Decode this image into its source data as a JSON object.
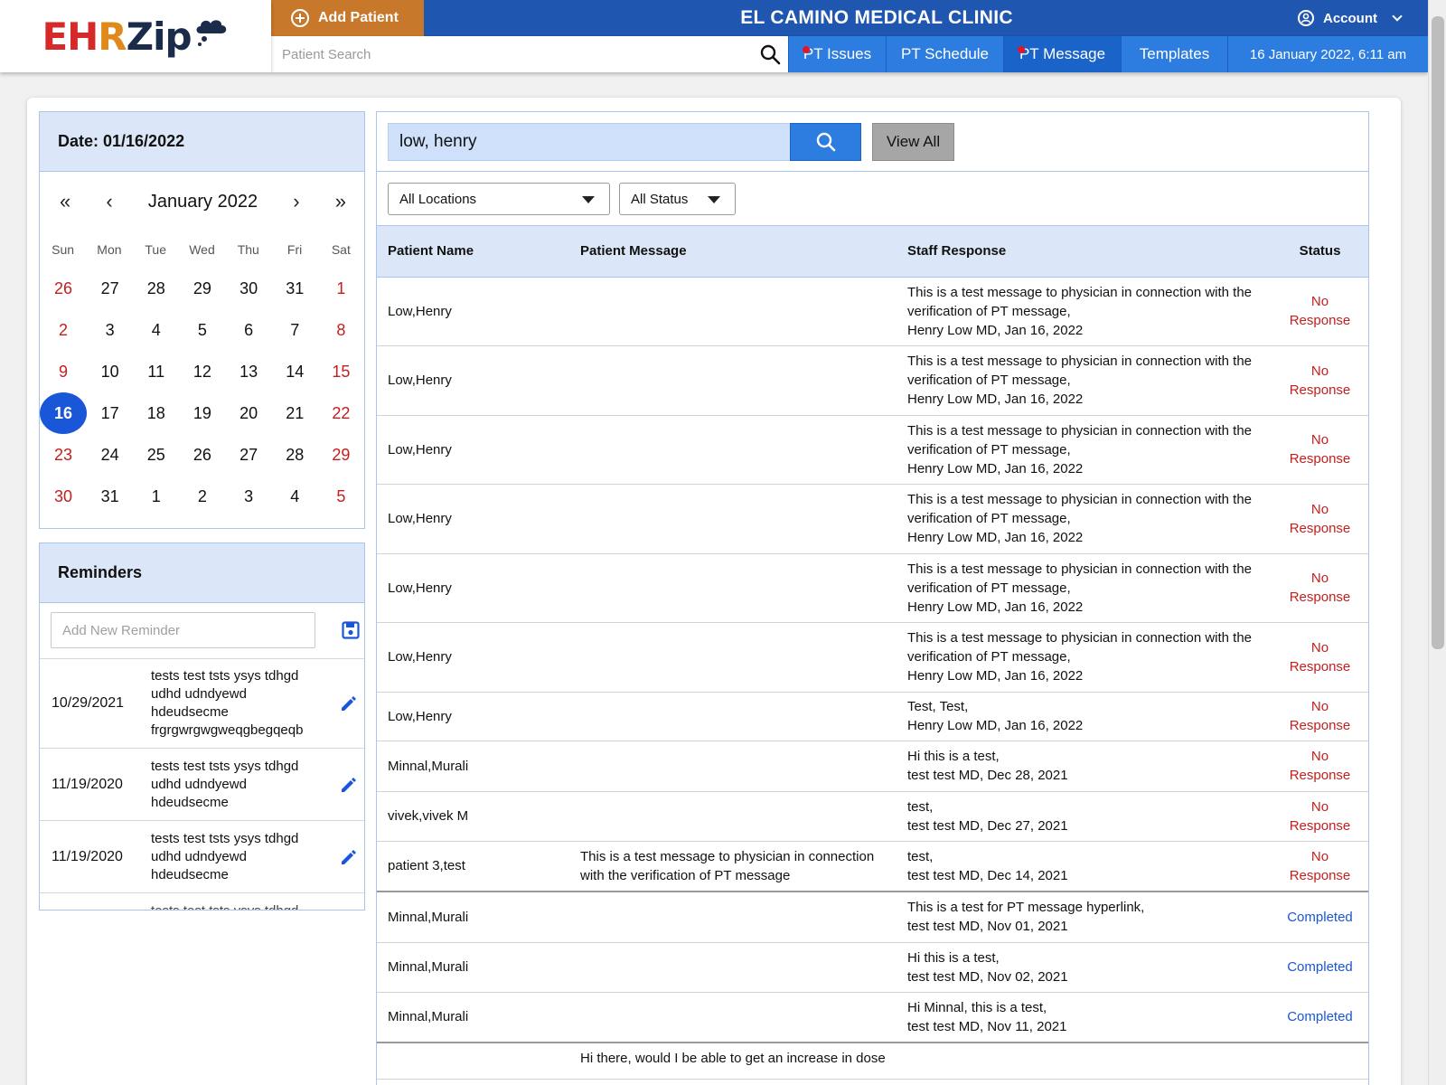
{
  "logo": {
    "part1": "EH",
    "part2": "R",
    "part3": "Zip"
  },
  "header": {
    "add_patient": "Add Patient",
    "clinic_name": "EL CAMINO MEDICAL CLINIC",
    "account": "Account"
  },
  "nav": {
    "search_placeholder": "Patient Search",
    "tabs": [
      {
        "label": "PT Issues",
        "badge": true
      },
      {
        "label": "PT Schedule",
        "badge": false
      },
      {
        "label": "PT Message",
        "badge": true,
        "active": true
      },
      {
        "label": "Templates",
        "badge": false
      }
    ],
    "datetime": "16 January 2022, 6:11 am"
  },
  "calendar": {
    "date_label": "Date: 01/16/2022",
    "nav_first": "«",
    "nav_prev": "‹",
    "nav_next": "›",
    "nav_last": "»",
    "month": "January 2022",
    "weekdays": [
      "Sun",
      "Mon",
      "Tue",
      "Wed",
      "Thu",
      "Fri",
      "Sat"
    ],
    "weeks": [
      [
        "26",
        "27",
        "28",
        "29",
        "30",
        "31",
        "1"
      ],
      [
        "2",
        "3",
        "4",
        "5",
        "6",
        "7",
        "8"
      ],
      [
        "9",
        "10",
        "11",
        "12",
        "13",
        "14",
        "15"
      ],
      [
        "16",
        "17",
        "18",
        "19",
        "20",
        "21",
        "22"
      ],
      [
        "23",
        "24",
        "25",
        "26",
        "27",
        "28",
        "29"
      ],
      [
        "30",
        "31",
        "1",
        "2",
        "3",
        "4",
        "5"
      ]
    ],
    "selected_day": "16"
  },
  "reminders": {
    "title": "Reminders",
    "placeholder": "Add New Reminder",
    "items": [
      {
        "date": "10/29/2021",
        "text": "tests test tsts ysys tdhgd udhd udndyewd hdeudsecme frgrgwrgwgweqgbegqeqb"
      },
      {
        "date": "11/19/2020",
        "text": "tests test tsts ysys tdhgd udhd udndyewd hdeudsecme"
      },
      {
        "date": "11/19/2020",
        "text": "tests test tsts ysys tdhgd udhd udndyewd hdeudsecme"
      }
    ],
    "cut_off_text": "tests test tsts ysys tdhgd"
  },
  "messages": {
    "search_value": "low, henry",
    "view_all": "View All",
    "location_filter": "All Locations",
    "status_filter": "All Status",
    "columns": [
      "Patient Name",
      "Patient Message",
      "Staff Response",
      "Status"
    ],
    "rows": [
      {
        "name": "Low,Henry",
        "message": "",
        "response": [
          "This is a test message to physician in connection with the verification of PT message,",
          "Henry Low MD, Jan 16, 2022"
        ],
        "status": "No Response"
      },
      {
        "name": "Low,Henry",
        "message": "",
        "response": [
          "This is a test message to physician in connection with the verification of PT message,",
          "Henry Low MD, Jan 16, 2022"
        ],
        "status": "No Response"
      },
      {
        "name": "Low,Henry",
        "message": "",
        "response": [
          "This is a test message to physician in connection with the verification of PT message,",
          "Henry Low MD, Jan 16, 2022"
        ],
        "status": "No Response"
      },
      {
        "name": "Low,Henry",
        "message": "",
        "response": [
          "This is a test message to physician in connection with the verification of PT message,",
          "Henry Low MD, Jan 16, 2022"
        ],
        "status": "No Response"
      },
      {
        "name": "Low,Henry",
        "message": "",
        "response": [
          "This is a test message to physician in connection with the verification of PT message,",
          "Henry Low MD, Jan 16, 2022"
        ],
        "status": "No Response"
      },
      {
        "name": "Low,Henry",
        "message": "",
        "response": [
          "This is a test message to physician in connection with the verification of PT message,",
          "Henry Low MD, Jan 16, 2022"
        ],
        "status": "No Response"
      },
      {
        "name": "Low,Henry",
        "message": "",
        "response": [
          "Test, Test,",
          "Henry Low MD, Jan 16, 2022"
        ],
        "status": "No Response"
      },
      {
        "name": "Minnal,Murali",
        "message": "",
        "response": [
          "Hi this is a test,",
          "test test MD, Dec 28, 2021"
        ],
        "status": "No Response"
      },
      {
        "name": "vivek,vivek M",
        "message": "",
        "response": [
          "test,",
          "test test MD, Dec 27, 2021"
        ],
        "status": "No Response"
      },
      {
        "name": "patient 3,test",
        "message": "This is a test message to physician in connection with the verification of PT message",
        "response": [
          "test,",
          "test test MD, Dec 14, 2021"
        ],
        "status": "No Response"
      },
      {
        "name": "Minnal,Murali",
        "message": "",
        "response": [
          "This is a test for PT message hyperlink,",
          "test test MD, Nov 01, 2021"
        ],
        "status": "Completed"
      },
      {
        "name": "Minnal,Murali",
        "message": "",
        "response": [
          "Hi this is a test,",
          "test test MD, Nov 02, 2021"
        ],
        "status": "Completed"
      },
      {
        "name": "Minnal,Murali",
        "message": "",
        "response": [
          "Hi Minnal, this is a test,",
          "test test MD, Nov 11, 2021"
        ],
        "status": "Completed"
      },
      {
        "name": "",
        "message": "Hi there, would I be able to get an increase in dose",
        "response": [],
        "status": ""
      }
    ]
  },
  "colors": {
    "brand_blue": "#1f56b0",
    "tab_blue": "#2d7de0",
    "add_patient_orange": "#c8782a",
    "panel_header": "#dbe7f8",
    "no_response_red": "#c41e1e",
    "completed_blue": "#1a56d8"
  }
}
